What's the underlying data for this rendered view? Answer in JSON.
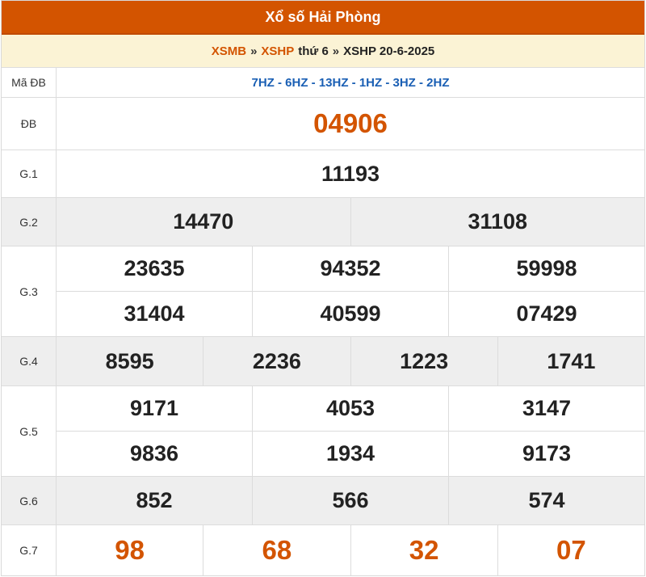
{
  "header": {
    "title": "Xổ số Hải Phòng"
  },
  "breadcrumb": {
    "link1": "XSMB",
    "sep1": "»",
    "link2": "XSHP",
    "day": "thứ 6",
    "sep2": "»",
    "current": "XSHP 20-6-2025"
  },
  "prizes": {
    "code": {
      "label": "Mã ĐB",
      "value": "7HZ - 6HZ - 13HZ - 1HZ - 3HZ - 2HZ"
    },
    "db": {
      "label": "ĐB",
      "value": "04906"
    },
    "g1": {
      "label": "G.1",
      "values": [
        "11193"
      ]
    },
    "g2": {
      "label": "G.2",
      "values": [
        "14470",
        "31108"
      ]
    },
    "g3": {
      "label": "G.3",
      "values": [
        "23635",
        "94352",
        "59998",
        "31404",
        "40599",
        "07429"
      ]
    },
    "g4": {
      "label": "G.4",
      "values": [
        "8595",
        "2236",
        "1223",
        "1741"
      ]
    },
    "g5": {
      "label": "G.5",
      "values": [
        "9171",
        "4053",
        "3147",
        "9836",
        "1934",
        "9173"
      ]
    },
    "g6": {
      "label": "G.6",
      "values": [
        "852",
        "566",
        "574"
      ]
    },
    "g7": {
      "label": "G.7",
      "values": [
        "98",
        "68",
        "32",
        "07"
      ]
    }
  },
  "colors": {
    "header_bg": "#d35400",
    "accent": "#d35400",
    "code_text": "#1a5fb4",
    "crumb_bg": "#fbf3d5",
    "alt_row": "#eeeeee"
  }
}
